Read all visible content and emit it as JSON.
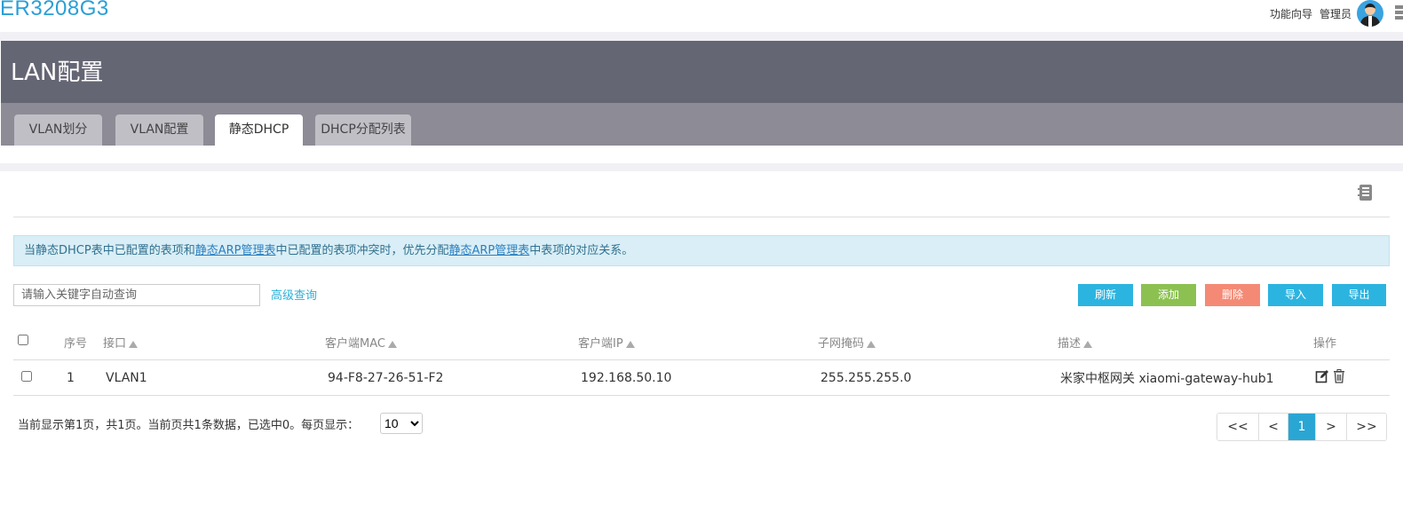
{
  "app": {
    "brand": "ER3208G3",
    "wizard_link": "功能向导",
    "user_label": "管理员"
  },
  "header": {
    "title": "LAN配置"
  },
  "tabs": [
    {
      "label": "VLAN划分",
      "active": false
    },
    {
      "label": "VLAN配置",
      "active": false
    },
    {
      "label": "静态DHCP",
      "active": true
    },
    {
      "label": "DHCP分配列表",
      "active": false
    }
  ],
  "notice": {
    "part1": "当静态DHCP表中已配置的表项和",
    "link1": "静态ARP管理表",
    "part2": "中已配置的表项冲突时，优先分配",
    "link2": "静态ARP管理表",
    "part3": "中表项的对应关系。"
  },
  "search": {
    "placeholder": "请输入关键字自动查询",
    "advanced_label": "高级查询"
  },
  "toolbar": {
    "refresh": "刷新",
    "add": "添加",
    "delete": "删除",
    "import": "导入",
    "export": "导出"
  },
  "table": {
    "headers": {
      "index": "序号",
      "interface": "接口",
      "mac": "客户端MAC",
      "ip": "客户端IP",
      "mask": "子网掩码",
      "desc": "描述",
      "ops": "操作"
    },
    "rows": [
      {
        "index": "1",
        "interface": "VLAN1",
        "mac": "94-F8-27-26-51-F2",
        "ip": "192.168.50.10",
        "mask": "255.255.255.0",
        "desc": "米家中枢网关 xiaomi-gateway-hub1"
      }
    ]
  },
  "pagination": {
    "summary": "当前显示第1页，共1页。当前页共1条数据，已选中0。每页显示：",
    "page_size": "10",
    "first": "<<",
    "prev": "<",
    "current": "1",
    "next": ">",
    "last": ">>"
  },
  "colors": {
    "brand": "#2a9fd6",
    "header_bg": "#656674",
    "tabbar_bg": "#8c8b96",
    "btn_blue": "#2cb4e0",
    "btn_green": "#8cc152",
    "btn_red": "#f48a75"
  },
  "icons": {
    "help": "help-book-icon",
    "edit": "edit-icon",
    "delete": "trash-icon",
    "settings": "settings-icon",
    "avatar": "user-avatar"
  }
}
